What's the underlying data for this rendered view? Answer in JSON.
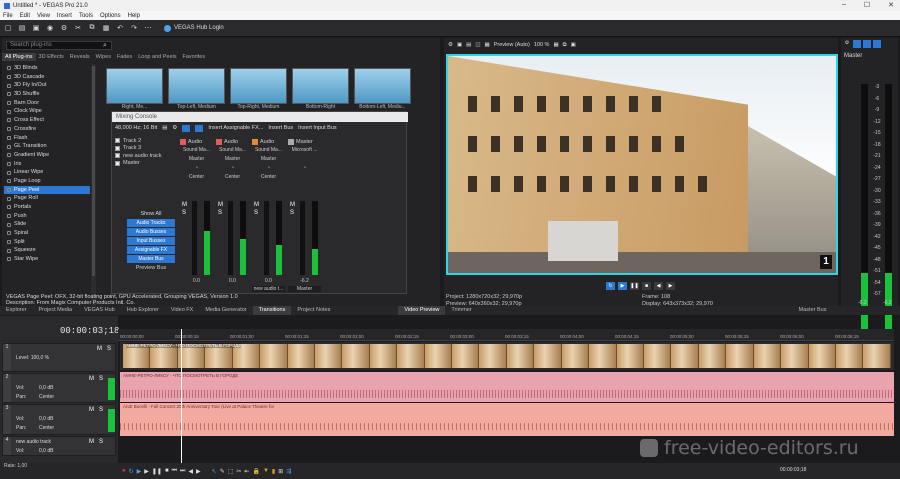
{
  "window": {
    "title": "Untitled * - VEGAS Pro 21.0"
  },
  "menu": [
    "File",
    "Edit",
    "View",
    "Insert",
    "Tools",
    "Options",
    "Help"
  ],
  "toolbar": {
    "hub_login": "VEGAS Hub Login"
  },
  "fx": {
    "search_placeholder": "Search plug-ins",
    "tabs": [
      "All Plug-ins",
      "3D Effects",
      "Reveals",
      "Wipes",
      "Fades",
      "Loop and Peels",
      "Favorites"
    ],
    "items": [
      "3D Blinds",
      "3D Cascade",
      "3D Fly In/Out",
      "3D Shuffle",
      "Barn Door",
      "Clock Wipe",
      "Cross Effect",
      "Crossfire",
      "Flash",
      "GL Transition",
      "Gradient Wipe",
      "Iris",
      "Linear Wipe",
      "Page Loop",
      "Page Peel",
      "Page Roll",
      "Portals",
      "Push",
      "Slide",
      "Spiral",
      "Split",
      "Squeeze",
      "Star Wipe"
    ],
    "selected": "Page Peel",
    "thumbs": [
      "Right, Me...",
      "Top-Left, Medium",
      "Top-Right, Medium",
      "Bottom-Right",
      "Bottom-Left, Mediu..."
    ]
  },
  "mixer": {
    "title": "Mixing Console",
    "format": "48,000 Hz; 16 Bit",
    "insert_fx": "Insert Assignable FX...",
    "insert_bus": "Insert Bus",
    "insert_input_bus": "Insert Input Bus",
    "tracks": [
      "Track 2",
      "Track 3",
      "new audio track",
      "Master"
    ],
    "show_all": "Show All",
    "buttons": [
      "Audio Tracks",
      "Audio Busses",
      "Input Busses",
      "Assignable FX",
      "Master Bus"
    ],
    "preview_bus": "Preview Bus",
    "strips": [
      {
        "type": "Audio",
        "out": "Sound Ma...",
        "route": "Master",
        "pan": "Center",
        "val": "0.0",
        "name": ""
      },
      {
        "type": "Audio",
        "out": "Sound Ma...",
        "route": "Master",
        "pan": "Center",
        "val": "0.0",
        "name": ""
      },
      {
        "type": "Audio",
        "out": "Sound Ma...",
        "route": "Master",
        "pan": "Center",
        "val": "0.0",
        "name": "new audio t..."
      },
      {
        "type": "Master",
        "out": "Microsoft ...",
        "route": "",
        "pan": "",
        "val": "-6.2",
        "name": "Master"
      }
    ]
  },
  "fxinfo": {
    "line1": "VEGAS Page Peel: OFX, 32-bit floating point, GPU Accelerated, Grouping VEGAS, Version 1.0",
    "line2": "Description: From Magix Computer Products Intl. Co."
  },
  "left_tabs": [
    "Explorer",
    "Project Media",
    "VEGAS Hub",
    "Hub Explorer",
    "Video FX",
    "Media Generator",
    "Transitions",
    "Project Notes"
  ],
  "preview": {
    "mode": "Preview (Auto)",
    "zoom": "100 %",
    "badge": "1",
    "project": "Project:  1280x720x32; 29,970p",
    "previewres": "Preview: 640x360x32; 29,970p",
    "frame": "Frame:     108",
    "display": "Display:   643x373x32; 29,970",
    "tabs": [
      "Video Preview",
      "Trimmer"
    ]
  },
  "master": {
    "title": "Master",
    "scale": [
      "-3",
      "-6",
      "-9",
      "-12",
      "-15",
      "-18",
      "-21",
      "-24",
      "-27",
      "-30",
      "-33",
      "-36",
      "-39",
      "-42",
      "-45",
      "-48",
      "-51",
      "-54",
      "-57"
    ],
    "left": "-6.2",
    "right": "-6.2",
    "tab": "Master Bus"
  },
  "timeline": {
    "timecode": "00:00:03;18",
    "ticks": [
      "00:00:00;00",
      "00:00:00;15",
      "00:00:01;00",
      "00:00:01;15",
      "00:00:02;00",
      "00:00:02;15",
      "00:00:03;00",
      "00:00:03;15",
      "00:00:04;00",
      "00:00:04;15",
      "00:00:05;00",
      "00:00:05;15",
      "00:00:06;00",
      "00:00:06;15"
    ],
    "video_level": "Level: 100,0 %",
    "video_clip": "АМНЕ-РЕТРО-ЛИКСУ - ЧТО ПОСМОТРЕТЬ В ГОРОДЕ",
    "audio1_clip": "АМНЕ-РЕТРО-ЛИКСУ - ЧТО ПОСМОТРЕТЬ В ГОРОДЕ",
    "audio2_clip": "Andr Bocelli - Full Concert 20th Anniversary Tour (Live at Palace Theatre for",
    "vol": "Vol:",
    "vol_val": "0,0 dB",
    "pan": "Pan:",
    "pan_val": "Center",
    "newtrack": "new audio track",
    "rate": "Rate: 1,00",
    "endtime": "00:00:03;18"
  },
  "watermark": "free-video-editors.ru",
  "colors": {
    "accent": "#2d78d2",
    "preview_border": "#30d5e3",
    "meter": "#19c23a"
  }
}
